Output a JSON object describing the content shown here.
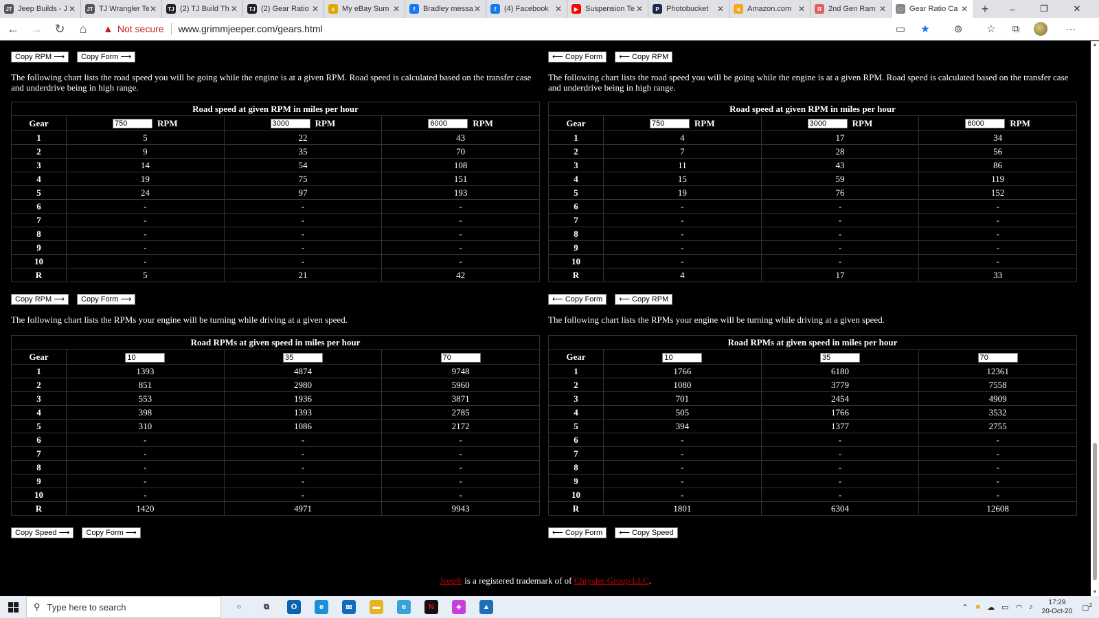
{
  "browser": {
    "tabs": [
      {
        "title": "Jeep Builds - J",
        "fav": "JT",
        "color": "#555555",
        "active": false
      },
      {
        "title": "TJ Wrangler Te",
        "fav": "JT",
        "color": "#555555",
        "active": false
      },
      {
        "title": "(2) TJ Build Th",
        "fav": "TJ",
        "color": "#222222",
        "active": false
      },
      {
        "title": "(2) Gear Ratio",
        "fav": "TJ",
        "color": "#222222",
        "active": false
      },
      {
        "title": "My eBay Sum",
        "fav": "e",
        "color": "#e0a800",
        "active": false
      },
      {
        "title": "Bradley messa",
        "fav": "f",
        "color": "#1877f2",
        "active": false
      },
      {
        "title": "(4) Facebook",
        "fav": "f",
        "color": "#1877f2",
        "active": false
      },
      {
        "title": "Suspension Te",
        "fav": "▶",
        "color": "#ff0000",
        "active": false
      },
      {
        "title": "Photobucket",
        "fav": "P",
        "color": "#1c2a4a",
        "active": false
      },
      {
        "title": "Amazon.com",
        "fav": "a",
        "color": "#f5a623",
        "active": false
      },
      {
        "title": "2nd Gen Ram",
        "fav": "R",
        "color": "#e06060",
        "active": false
      },
      {
        "title": "Gear Ratio Ca",
        "fav": "□",
        "color": "#888888",
        "active": true
      }
    ],
    "new_tab": "+",
    "window_controls": {
      "minimize": "–",
      "restore": "❐",
      "close": "✕"
    },
    "nav": {
      "back": "←",
      "forward": "→",
      "reload": "↻",
      "home": "⌂"
    },
    "security_label": "Not secure",
    "url": "www.grimmjeeper.com/gears.html",
    "toolbar_icons": [
      "reader-icon",
      "star-icon",
      "extension-icon",
      "favorites-icon",
      "collections-icon",
      "profile-icon",
      "menu-icon"
    ],
    "menu_glyph": "···"
  },
  "page": {
    "left": {
      "speed_buttons": [
        "Copy RPM ⟶",
        "Copy Form ⟶"
      ],
      "speed_desc": "The following chart lists the road speed you will be going while the engine is at a given RPM. Road speed is calculated based on the transfer case and underdrive being in high range.",
      "speed_table": {
        "caption": "Road speed at given RPM in miles per hour",
        "gear_label": "Gear",
        "unit": "RPM",
        "inputs": [
          "750",
          "3000",
          "6000"
        ],
        "rows": [
          [
            "1",
            "5",
            "22",
            "43"
          ],
          [
            "2",
            "9",
            "35",
            "70"
          ],
          [
            "3",
            "14",
            "54",
            "108"
          ],
          [
            "4",
            "19",
            "75",
            "151"
          ],
          [
            "5",
            "24",
            "97",
            "193"
          ],
          [
            "6",
            "-",
            "-",
            "-"
          ],
          [
            "7",
            "-",
            "-",
            "-"
          ],
          [
            "8",
            "-",
            "-",
            "-"
          ],
          [
            "9",
            "-",
            "-",
            "-"
          ],
          [
            "10",
            "-",
            "-",
            "-"
          ],
          [
            "R",
            "5",
            "21",
            "42"
          ]
        ]
      },
      "rpm_buttons_top": [
        "Copy RPM ⟶",
        "Copy Form ⟶"
      ],
      "rpm_desc": "The following chart lists the RPMs your engine will be turning while driving at a given speed.",
      "rpm_table": {
        "caption": "Road RPMs at given speed in miles per hour",
        "gear_label": "Gear",
        "inputs": [
          "10",
          "35",
          "70"
        ],
        "rows": [
          [
            "1",
            "1393",
            "4874",
            "9748"
          ],
          [
            "2",
            "851",
            "2980",
            "5960"
          ],
          [
            "3",
            "553",
            "1936",
            "3871"
          ],
          [
            "4",
            "398",
            "1393",
            "2785"
          ],
          [
            "5",
            "310",
            "1086",
            "2172"
          ],
          [
            "6",
            "-",
            "-",
            "-"
          ],
          [
            "7",
            "-",
            "-",
            "-"
          ],
          [
            "8",
            "-",
            "-",
            "-"
          ],
          [
            "9",
            "-",
            "-",
            "-"
          ],
          [
            "10",
            "-",
            "-",
            "-"
          ],
          [
            "R",
            "1420",
            "4971",
            "9943"
          ]
        ]
      },
      "bottom_buttons": [
        "Copy Speed ⟶",
        "Copy Form ⟶"
      ]
    },
    "right": {
      "speed_buttons": [
        "⟵ Copy Form",
        "⟵ Copy RPM"
      ],
      "speed_desc": "The following chart lists the road speed you will be going while the engine is at a given RPM. Road speed is calculated based on the transfer case and underdrive being in high range.",
      "speed_table": {
        "caption": "Road speed at given RPM in miles per hour",
        "gear_label": "Gear",
        "unit": "RPM",
        "inputs": [
          "750",
          "3000",
          "6000"
        ],
        "rows": [
          [
            "1",
            "4",
            "17",
            "34"
          ],
          [
            "2",
            "7",
            "28",
            "56"
          ],
          [
            "3",
            "11",
            "43",
            "86"
          ],
          [
            "4",
            "15",
            "59",
            "119"
          ],
          [
            "5",
            "19",
            "76",
            "152"
          ],
          [
            "6",
            "-",
            "-",
            "-"
          ],
          [
            "7",
            "-",
            "-",
            "-"
          ],
          [
            "8",
            "-",
            "-",
            "-"
          ],
          [
            "9",
            "-",
            "-",
            "-"
          ],
          [
            "10",
            "-",
            "-",
            "-"
          ],
          [
            "R",
            "4",
            "17",
            "33"
          ]
        ]
      },
      "rpm_buttons_top": [
        "⟵ Copy Form",
        "⟵ Copy RPM"
      ],
      "rpm_desc": "The following chart lists the RPMs your engine will be turning while driving at a given speed.",
      "rpm_table": {
        "caption": "Road RPMs at given speed in miles per hour",
        "gear_label": "Gear",
        "inputs": [
          "10",
          "35",
          "70"
        ],
        "rows": [
          [
            "1",
            "1766",
            "6180",
            "12361"
          ],
          [
            "2",
            "1080",
            "3779",
            "7558"
          ],
          [
            "3",
            "701",
            "2454",
            "4909"
          ],
          [
            "4",
            "505",
            "1766",
            "3532"
          ],
          [
            "5",
            "394",
            "1377",
            "2755"
          ],
          [
            "6",
            "-",
            "-",
            "-"
          ],
          [
            "7",
            "-",
            "-",
            "-"
          ],
          [
            "8",
            "-",
            "-",
            "-"
          ],
          [
            "9",
            "-",
            "-",
            "-"
          ],
          [
            "10",
            "-",
            "-",
            "-"
          ],
          [
            "R",
            "1801",
            "6304",
            "12608"
          ]
        ]
      },
      "bottom_buttons": [
        "⟵ Copy Form",
        "⟵ Copy Speed"
      ]
    },
    "footer": {
      "jeep_link": "Jeep®",
      "middle": " is a registered trademark of of ",
      "chrysler_link": "Chrysler Group LLC",
      "end": "."
    }
  },
  "taskbar": {
    "search_placeholder": "Type here to search",
    "apps": [
      {
        "name": "cortana-icon",
        "glyph": "○",
        "color": "#e8eef5",
        "fg": "#222"
      },
      {
        "name": "task-view-icon",
        "glyph": "⧉",
        "color": "#e8eef5",
        "fg": "#222"
      },
      {
        "name": "outlook-icon",
        "glyph": "O",
        "color": "#0a64ad",
        "fg": "#fff"
      },
      {
        "name": "edge-icon",
        "glyph": "e",
        "color": "#1d8fd8",
        "fg": "#fff"
      },
      {
        "name": "mail-icon",
        "glyph": "✉",
        "color": "#0f6cbd",
        "fg": "#fff"
      },
      {
        "name": "file-explorer-icon",
        "glyph": "▬",
        "color": "#e6b422",
        "fg": "#fff"
      },
      {
        "name": "ie-icon",
        "glyph": "e",
        "color": "#3aa0d8",
        "fg": "#fff"
      },
      {
        "name": "netflix-icon",
        "glyph": "N",
        "color": "#111",
        "fg": "#e50914"
      },
      {
        "name": "messenger-icon",
        "glyph": "✦",
        "color": "#c53fe0",
        "fg": "#fff"
      },
      {
        "name": "photos-icon",
        "glyph": "▲",
        "color": "#1e6fb8",
        "fg": "#fff"
      }
    ],
    "time": "17:29",
    "date": "20-Oct-20",
    "notifications": "2"
  }
}
